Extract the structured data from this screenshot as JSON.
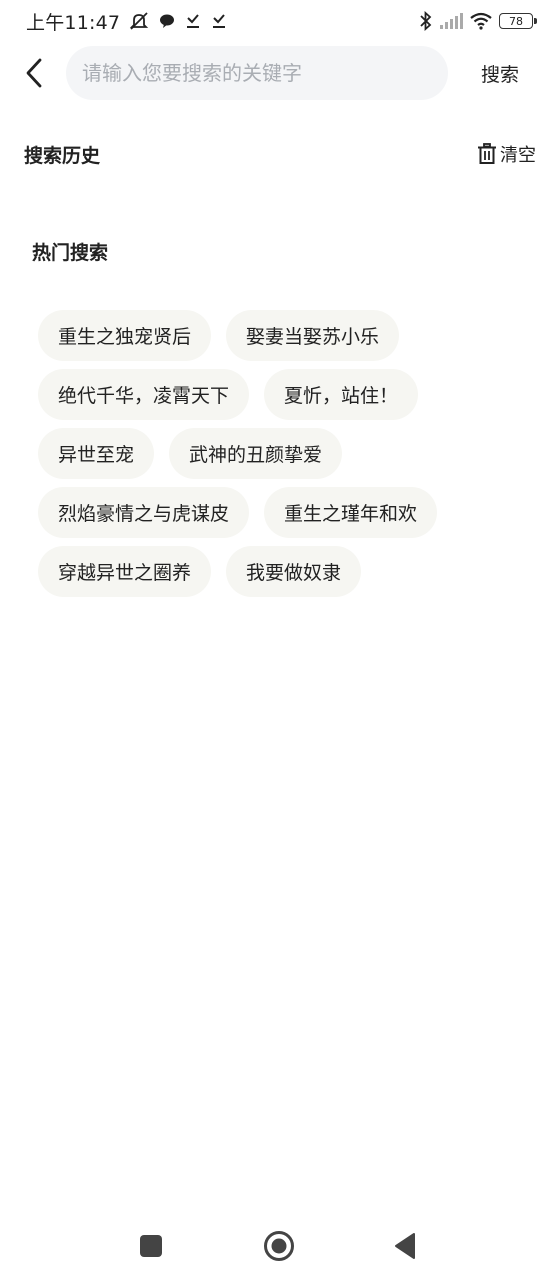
{
  "status_bar": {
    "time": "上午11:47",
    "battery": "78",
    "icons": [
      "mute-icon",
      "chat-bubble-icon",
      "download-check-icon",
      "download-check-icon",
      "bluetooth-icon",
      "signal-icon",
      "wifi-icon",
      "battery-icon"
    ]
  },
  "search": {
    "placeholder": "请输入您要搜索的关键字",
    "value": "",
    "button_label": "搜索"
  },
  "history": {
    "title": "搜索历史",
    "clear_label": "清空"
  },
  "hot": {
    "title": "热门搜索",
    "tags": [
      "重生之独宠贤后",
      "娶妻当娶苏小乐",
      "绝代千华，凌霄天下",
      "夏忻，站住！",
      "异世至宠",
      "武神的丑颜挚爱",
      "烈焰豪情之与虎谋皮",
      "重生之瑾年和欢",
      "穿越异世之圈养",
      "我要做奴隶"
    ]
  },
  "nav_bar": {
    "icons": [
      "recent-apps-icon",
      "home-icon",
      "back-triangle-icon"
    ]
  }
}
